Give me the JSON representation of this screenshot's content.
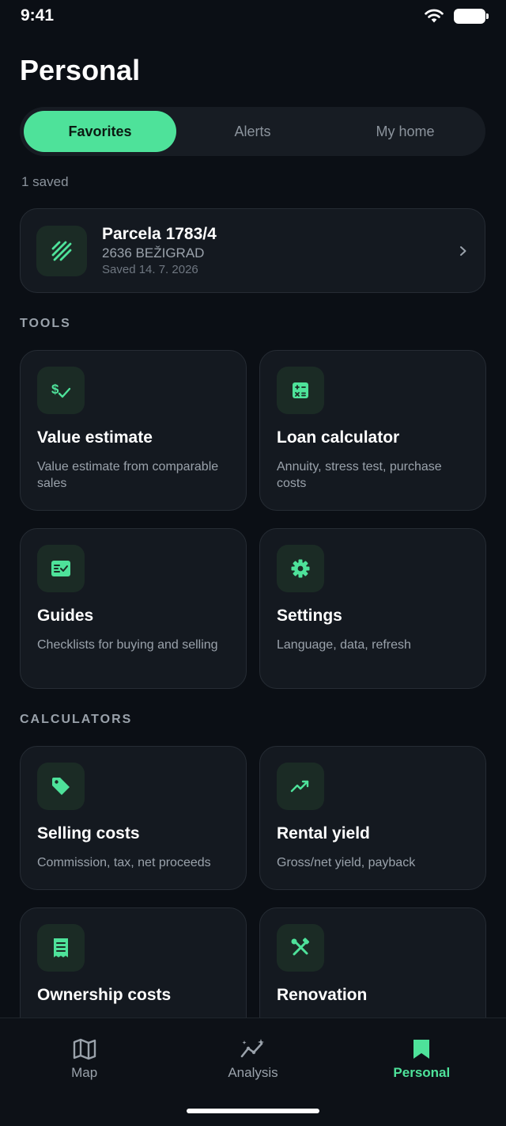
{
  "status_bar": {
    "time": "9:41"
  },
  "page": {
    "title": "Personal"
  },
  "tabs": [
    {
      "label": "Favorites",
      "active": true
    },
    {
      "label": "Alerts",
      "active": false
    },
    {
      "label": "My home",
      "active": false
    }
  ],
  "favorites": {
    "count_label": "1 saved",
    "items": [
      {
        "title": "Parcela 1783/4",
        "subtitle": "2636 BEŽIGRAD",
        "saved": "Saved 14. 7. 2026"
      }
    ]
  },
  "tools": {
    "label": "TOOLS",
    "items": [
      {
        "title": "Value estimate",
        "desc": "Value estimate from comparable sales",
        "icon": "dollar-check-icon"
      },
      {
        "title": "Loan calculator",
        "desc": "Annuity, stress test, purchase costs",
        "icon": "calculator-icon"
      },
      {
        "title": "Guides",
        "desc": "Checklists for buying and selling",
        "icon": "checklist-icon"
      },
      {
        "title": "Settings",
        "desc": "Language, data, refresh",
        "icon": "gear-icon"
      }
    ]
  },
  "calculators": {
    "label": "CALCULATORS",
    "items": [
      {
        "title": "Selling costs",
        "desc": "Commission, tax, net proceeds",
        "icon": "tag-icon"
      },
      {
        "title": "Rental yield",
        "desc": "Gross/net yield, payback",
        "icon": "trending-up-icon"
      },
      {
        "title": "Ownership costs",
        "desc": "",
        "icon": "receipt-icon"
      },
      {
        "title": "Renovation",
        "desc": "",
        "icon": "tools-icon"
      }
    ]
  },
  "nav": [
    {
      "label": "Map",
      "icon": "map-icon",
      "active": false
    },
    {
      "label": "Analysis",
      "icon": "analysis-icon",
      "active": false
    },
    {
      "label": "Personal",
      "icon": "bookmark-icon",
      "active": true
    }
  ],
  "colors": {
    "accent": "#4ee29a",
    "background": "#0b0f15",
    "card": "#141920"
  }
}
